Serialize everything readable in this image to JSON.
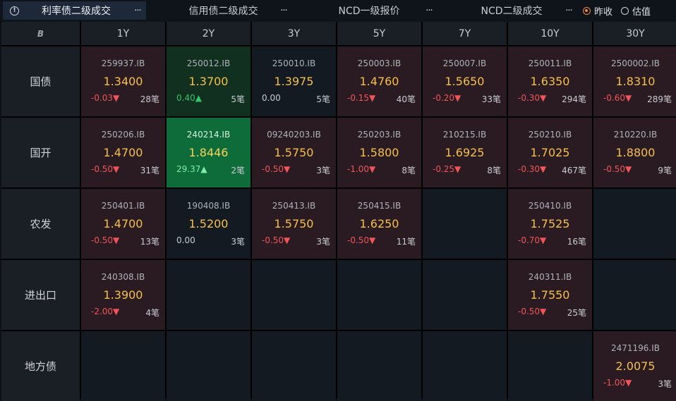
{
  "tabs": [
    {
      "label": "利率债二级成交",
      "more": "···",
      "active": true
    },
    {
      "label": "信用债二级成交",
      "more": "···",
      "active": false
    },
    {
      "label": "NCD一级报价",
      "more": "···",
      "active": false
    },
    {
      "label": "NCD二级成交",
      "more": "···",
      "active": false
    }
  ],
  "radios": [
    {
      "label": "昨收",
      "checked": true
    },
    {
      "label": "估值",
      "checked": false
    }
  ],
  "table": {
    "corner": "B",
    "columns": [
      "1Y",
      "2Y",
      "3Y",
      "5Y",
      "7Y",
      "10Y",
      "30Y"
    ],
    "rows": [
      {
        "label": "国债",
        "cells": [
          {
            "code": "259937.IB",
            "price": "1.3400",
            "change": "-0.03▼",
            "count": "28笔",
            "dir": "down",
            "tone": "red"
          },
          {
            "code": "250012.IB",
            "price": "1.3700",
            "change": "0.40▲",
            "count": "5笔",
            "dir": "up",
            "tone": "green"
          },
          {
            "code": "250010.IB",
            "price": "1.3975",
            "change": "0.00",
            "count": "5笔",
            "dir": "flat",
            "tone": "neutral"
          },
          {
            "code": "250003.IB",
            "price": "1.4760",
            "change": "-0.15▼",
            "count": "40笔",
            "dir": "down",
            "tone": "red"
          },
          {
            "code": "250007.IB",
            "price": "1.5650",
            "change": "-0.20▼",
            "count": "33笔",
            "dir": "down",
            "tone": "red"
          },
          {
            "code": "250011.IB",
            "price": "1.6350",
            "change": "-0.30▼",
            "count": "294笔",
            "dir": "down",
            "tone": "red"
          },
          {
            "code": "2500002.IB",
            "price": "1.8310",
            "change": "-0.60▼",
            "count": "289笔",
            "dir": "down",
            "tone": "red"
          }
        ]
      },
      {
        "label": "国开",
        "cells": [
          {
            "code": "250206.IB",
            "price": "1.4700",
            "change": "-0.50▼",
            "count": "31笔",
            "dir": "down",
            "tone": "red"
          },
          {
            "code": "240214.IB",
            "price": "1.8446",
            "change": "29.37▲",
            "count": "2笔",
            "dir": "up",
            "tone": "bright"
          },
          {
            "code": "09240203.IB",
            "price": "1.5750",
            "change": "-0.50▼",
            "count": "3笔",
            "dir": "down",
            "tone": "red"
          },
          {
            "code": "250203.IB",
            "price": "1.5800",
            "change": "-1.00▼",
            "count": "8笔",
            "dir": "down",
            "tone": "red"
          },
          {
            "code": "210215.IB",
            "price": "1.6925",
            "change": "-0.25▼",
            "count": "8笔",
            "dir": "down",
            "tone": "red"
          },
          {
            "code": "250210.IB",
            "price": "1.7025",
            "change": "-0.30▼",
            "count": "467笔",
            "dir": "down",
            "tone": "red"
          },
          {
            "code": "210220.IB",
            "price": "1.8800",
            "change": "-0.50▼",
            "count": "9笔",
            "dir": "down",
            "tone": "red"
          }
        ]
      },
      {
        "label": "农发",
        "cells": [
          {
            "code": "250401.IB",
            "price": "1.4700",
            "change": "-0.50▼",
            "count": "13笔",
            "dir": "down",
            "tone": "red"
          },
          {
            "code": "190408.IB",
            "price": "1.5200",
            "change": "0.00",
            "count": "3笔",
            "dir": "flat",
            "tone": "neutral"
          },
          {
            "code": "250413.IB",
            "price": "1.5750",
            "change": "-0.50▼",
            "count": "3笔",
            "dir": "down",
            "tone": "red"
          },
          {
            "code": "250415.IB",
            "price": "1.6250",
            "change": "-0.50▼",
            "count": "11笔",
            "dir": "down",
            "tone": "red"
          },
          null,
          {
            "code": "250410.IB",
            "price": "1.7525",
            "change": "-0.70▼",
            "count": "16笔",
            "dir": "down",
            "tone": "red"
          },
          null
        ]
      },
      {
        "label": "进出口",
        "cells": [
          {
            "code": "240308.IB",
            "price": "1.3900",
            "change": "-2.00▼",
            "count": "4笔",
            "dir": "down",
            "tone": "red"
          },
          null,
          null,
          null,
          null,
          {
            "code": "240311.IB",
            "price": "1.7550",
            "change": "-0.50▼",
            "count": "25笔",
            "dir": "down",
            "tone": "red"
          },
          null
        ]
      },
      {
        "label": "地方债",
        "cells": [
          null,
          null,
          null,
          null,
          null,
          null,
          {
            "code": "2471196.IB",
            "price": "2.0075",
            "change": "-1.00▼",
            "count": "3笔",
            "dir": "down",
            "tone": "red"
          }
        ]
      }
    ]
  },
  "colors": {
    "price": "#f5c04a",
    "down": "#f0555a",
    "up": "#35c46b",
    "accent": "#f08a3c"
  }
}
